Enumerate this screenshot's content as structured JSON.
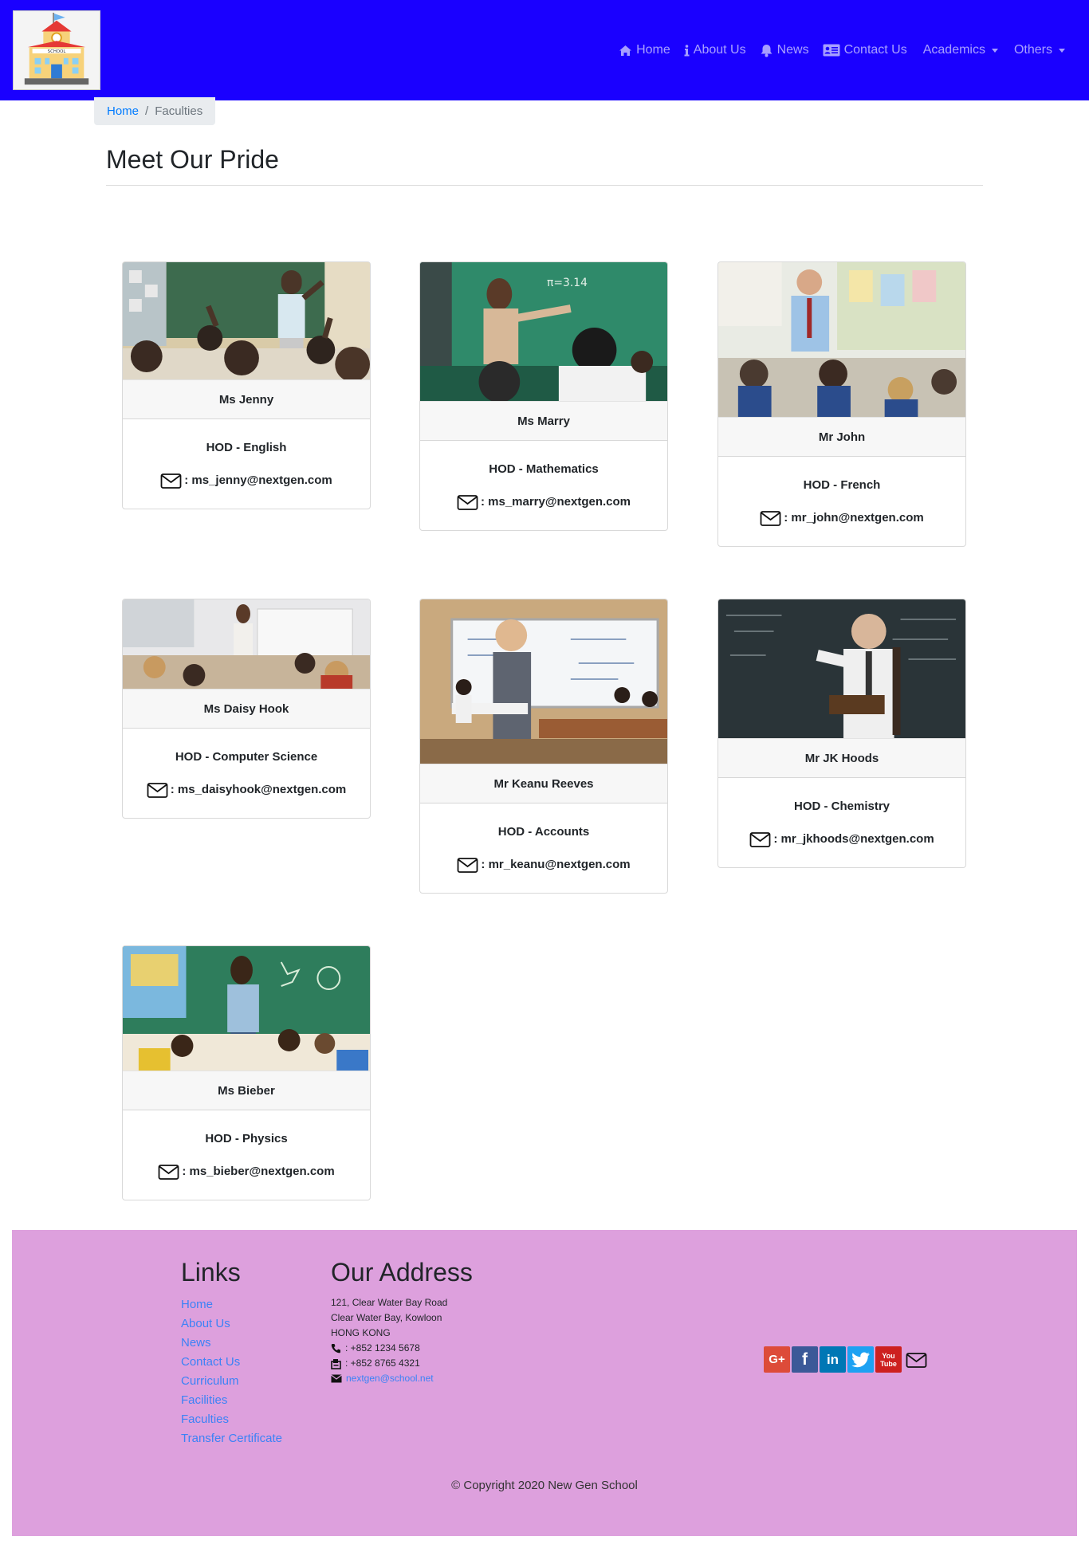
{
  "nav": {
    "logo_text": "SCHOOL",
    "items": [
      {
        "label": "Home",
        "icon": "home-icon"
      },
      {
        "label": "About Us",
        "icon": "info-icon"
      },
      {
        "label": "News",
        "icon": "bell-icon"
      },
      {
        "label": "Contact Us",
        "icon": "contact-card-icon"
      }
    ],
    "dropdowns": [
      "Academics",
      "Others"
    ]
  },
  "breadcrumb": {
    "home": "Home",
    "separator": "/",
    "current": "Faculties"
  },
  "page": {
    "title": "Meet Our Pride"
  },
  "faculty": [
    {
      "name": "Ms Jenny",
      "role": "HOD - English",
      "email": ": ms_jenny@nextgen.com"
    },
    {
      "name": "Ms Marry",
      "role": "HOD - Mathematics",
      "email": ": ms_marry@nextgen.com"
    },
    {
      "name": "Mr John",
      "role": "HOD - French",
      "email": ": mr_john@nextgen.com"
    },
    {
      "name": "Ms Daisy Hook",
      "role": "HOD - Computer Science",
      "email": ": ms_daisyhook@nextgen.com"
    },
    {
      "name": "Mr Keanu Reeves",
      "role": "HOD - Accounts",
      "email": ": mr_keanu@nextgen.com"
    },
    {
      "name": "Mr JK Hoods",
      "role": "HOD - Chemistry",
      "email": ": mr_jkhoods@nextgen.com"
    },
    {
      "name": "Ms Bieber",
      "role": "HOD - Physics",
      "email": ": ms_bieber@nextgen.com"
    }
  ],
  "footer": {
    "links_title": "Links",
    "links": [
      "Home",
      "About Us",
      "News",
      "Contact Us",
      "Curriculum",
      "Facilities",
      "Faculties",
      "Transfer Certificate"
    ],
    "address_title": "Our Address",
    "address_lines": [
      "121, Clear Water Bay Road",
      "Clear Water Bay, Kowloon",
      "HONG KONG"
    ],
    "phone": ": +852 1234 5678",
    "fax": ": +852 8765 4321",
    "email": "nextgen@school.net",
    "social": {
      "gplus": "G+",
      "facebook": "f",
      "linkedin": "in",
      "twitter": "t",
      "youtube_top": "You",
      "youtube_bottom": "Tube"
    },
    "copyright": "© Copyright 2020 New Gen School"
  },
  "colors": {
    "navbar": "#1a00ff",
    "footer": "#dda0dd",
    "link": "#3b82f6",
    "gplus": "#dd4b39",
    "facebook": "#3b5998",
    "linkedin": "#0077b5",
    "twitter": "#1da1f2",
    "youtube": "#cd201f"
  }
}
